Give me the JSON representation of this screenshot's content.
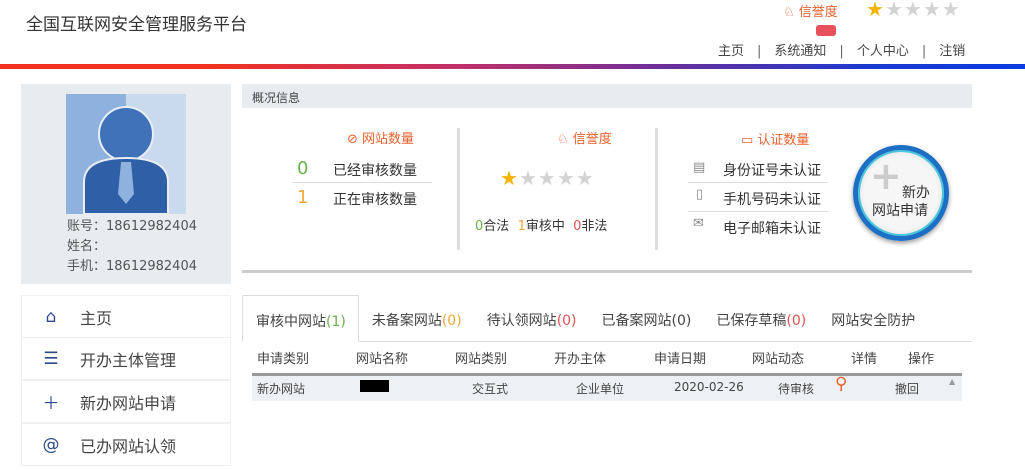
{
  "header": {
    "title": "全国互联网安全管理服务平台",
    "reputation_label": "信誉度",
    "reputation_stars": 1,
    "reputation_max": 5,
    "nav": [
      "主页",
      "系统通知",
      "个人中心",
      "注销"
    ]
  },
  "profile": {
    "account": "账号：18612982404",
    "name": "姓名：",
    "phone": "手机：18612982404"
  },
  "sidebar": {
    "items": [
      {
        "label": "主页",
        "icon": "home-icon"
      },
      {
        "label": "开办主体管理",
        "icon": "list-icon"
      },
      {
        "label": "新办网站申请",
        "icon": "plus-icon"
      },
      {
        "label": "已办网站认领",
        "icon": "at-icon"
      }
    ]
  },
  "overview": {
    "title": "概况信息",
    "sites": {
      "title": "网站数量",
      "reviewed_count": "0",
      "reviewed_label": "已经审核数量",
      "reviewing_count": "1",
      "reviewing_label": "正在审核数量"
    },
    "reputation": {
      "title": "信誉度",
      "stars": 1,
      "legal_count": "0",
      "legal_label": "合法",
      "reviewing_count": "1",
      "reviewing_label": "审核中",
      "illegal_count": "0",
      "illegal_label": "非法"
    },
    "certs": {
      "title": "认证数量",
      "id": "身份证号未认证",
      "phone": "手机号码未认证",
      "email": "电子邮箱未认证"
    },
    "new_button": {
      "line1": "新办",
      "line2": "网站申请"
    }
  },
  "tabs": [
    {
      "label": "审核中网站",
      "count": "(1)",
      "color": "#6ab04c"
    },
    {
      "label": "未备案网站",
      "count": "(0)",
      "color": "#f0a63c"
    },
    {
      "label": "待认领网站",
      "count": "(0)",
      "color": "#e2534f"
    },
    {
      "label": "已备案网站",
      "count": "(0)",
      "color": "#444"
    },
    {
      "label": "已保存草稿",
      "count": "(0)",
      "color": "#e2534f"
    },
    {
      "label": "网站安全防护",
      "count": "",
      "color": "#444"
    }
  ],
  "table": {
    "columns": [
      "申请类别",
      "网站名称",
      "网站类别",
      "开办主体",
      "申请日期",
      "网站动态",
      "详情",
      "操作"
    ],
    "rows": [
      {
        "type": "新办网站",
        "site_type": "交互式",
        "subject": "企业单位",
        "date": "2020-02-26",
        "status": "待审核",
        "action": "撤回"
      }
    ]
  }
}
